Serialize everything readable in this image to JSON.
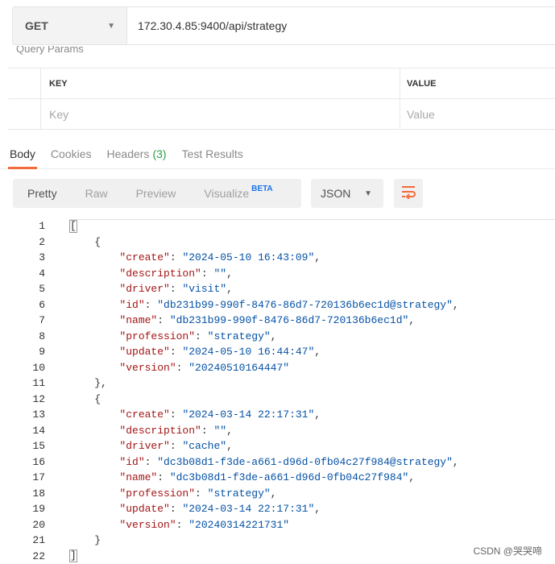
{
  "request": {
    "method": "GET",
    "url": "172.30.4.85:9400/api/strategy"
  },
  "params": {
    "cut_label": "Query Params",
    "col_key": "KEY",
    "col_value": "VALUE",
    "placeholder_key": "Key",
    "placeholder_value": "Value"
  },
  "response_tabs": {
    "body": "Body",
    "cookies": "Cookies",
    "headers": "Headers",
    "headers_count": "(3)",
    "test_results": "Test Results",
    "active": "Body"
  },
  "view": {
    "pretty": "Pretty",
    "raw": "Raw",
    "preview": "Preview",
    "visualize": "Visualize",
    "beta": "BETA",
    "format": "JSON",
    "active": "Pretty"
  },
  "code": {
    "lines": [
      {
        "n": "1",
        "indent": "",
        "parts": [
          [
            "p",
            "["
          ]
        ]
      },
      {
        "n": "2",
        "indent": "    ",
        "parts": [
          [
            "p",
            "{"
          ]
        ]
      },
      {
        "n": "3",
        "indent": "        ",
        "parts": [
          [
            "k",
            "\"create\""
          ],
          [
            "p",
            ": "
          ],
          [
            "v",
            "\"2024-05-10 16:43:09\""
          ],
          [
            "p",
            ","
          ]
        ]
      },
      {
        "n": "4",
        "indent": "        ",
        "parts": [
          [
            "k",
            "\"description\""
          ],
          [
            "p",
            ": "
          ],
          [
            "v",
            "\"\""
          ],
          [
            "p",
            ","
          ]
        ]
      },
      {
        "n": "5",
        "indent": "        ",
        "parts": [
          [
            "k",
            "\"driver\""
          ],
          [
            "p",
            ": "
          ],
          [
            "v",
            "\"visit\""
          ],
          [
            "p",
            ","
          ]
        ]
      },
      {
        "n": "6",
        "indent": "        ",
        "parts": [
          [
            "k",
            "\"id\""
          ],
          [
            "p",
            ": "
          ],
          [
            "v",
            "\"db231b99-990f-8476-86d7-720136b6ec1d@strategy\""
          ],
          [
            "p",
            ","
          ]
        ]
      },
      {
        "n": "7",
        "indent": "        ",
        "parts": [
          [
            "k",
            "\"name\""
          ],
          [
            "p",
            ": "
          ],
          [
            "v",
            "\"db231b99-990f-8476-86d7-720136b6ec1d\""
          ],
          [
            "p",
            ","
          ]
        ]
      },
      {
        "n": "8",
        "indent": "        ",
        "parts": [
          [
            "k",
            "\"profession\""
          ],
          [
            "p",
            ": "
          ],
          [
            "v",
            "\"strategy\""
          ],
          [
            "p",
            ","
          ]
        ]
      },
      {
        "n": "9",
        "indent": "        ",
        "parts": [
          [
            "k",
            "\"update\""
          ],
          [
            "p",
            ": "
          ],
          [
            "v",
            "\"2024-05-10 16:44:47\""
          ],
          [
            "p",
            ","
          ]
        ]
      },
      {
        "n": "10",
        "indent": "        ",
        "parts": [
          [
            "k",
            "\"version\""
          ],
          [
            "p",
            ": "
          ],
          [
            "v",
            "\"20240510164447\""
          ]
        ]
      },
      {
        "n": "11",
        "indent": "    ",
        "parts": [
          [
            "p",
            "},"
          ]
        ]
      },
      {
        "n": "12",
        "indent": "    ",
        "parts": [
          [
            "p",
            "{"
          ]
        ]
      },
      {
        "n": "13",
        "indent": "        ",
        "parts": [
          [
            "k",
            "\"create\""
          ],
          [
            "p",
            ": "
          ],
          [
            "v",
            "\"2024-03-14 22:17:31\""
          ],
          [
            "p",
            ","
          ]
        ]
      },
      {
        "n": "14",
        "indent": "        ",
        "parts": [
          [
            "k",
            "\"description\""
          ],
          [
            "p",
            ": "
          ],
          [
            "v",
            "\"\""
          ],
          [
            "p",
            ","
          ]
        ]
      },
      {
        "n": "15",
        "indent": "        ",
        "parts": [
          [
            "k",
            "\"driver\""
          ],
          [
            "p",
            ": "
          ],
          [
            "v",
            "\"cache\""
          ],
          [
            "p",
            ","
          ]
        ]
      },
      {
        "n": "16",
        "indent": "        ",
        "parts": [
          [
            "k",
            "\"id\""
          ],
          [
            "p",
            ": "
          ],
          [
            "v",
            "\"dc3b08d1-f3de-a661-d96d-0fb04c27f984@strategy\""
          ],
          [
            "p",
            ","
          ]
        ]
      },
      {
        "n": "17",
        "indent": "        ",
        "parts": [
          [
            "k",
            "\"name\""
          ],
          [
            "p",
            ": "
          ],
          [
            "v",
            "\"dc3b08d1-f3de-a661-d96d-0fb04c27f984\""
          ],
          [
            "p",
            ","
          ]
        ]
      },
      {
        "n": "18",
        "indent": "        ",
        "parts": [
          [
            "k",
            "\"profession\""
          ],
          [
            "p",
            ": "
          ],
          [
            "v",
            "\"strategy\""
          ],
          [
            "p",
            ","
          ]
        ]
      },
      {
        "n": "19",
        "indent": "        ",
        "parts": [
          [
            "k",
            "\"update\""
          ],
          [
            "p",
            ": "
          ],
          [
            "v",
            "\"2024-03-14 22:17:31\""
          ],
          [
            "p",
            ","
          ]
        ]
      },
      {
        "n": "20",
        "indent": "        ",
        "parts": [
          [
            "k",
            "\"version\""
          ],
          [
            "p",
            ": "
          ],
          [
            "v",
            "\"20240314221731\""
          ]
        ]
      },
      {
        "n": "21",
        "indent": "    ",
        "parts": [
          [
            "p",
            "}"
          ]
        ]
      },
      {
        "n": "22",
        "indent": "",
        "parts": [
          [
            "p",
            "]"
          ]
        ]
      }
    ]
  },
  "watermark": "CSDN @哭哭啼",
  "colors": {
    "accent_tab": "#f26b3a",
    "headers_count": "#27a243",
    "beta": "#1e74e8",
    "json_key": "#a31515",
    "json_string": "#0451a5",
    "wrap_icon": "#f26b3a"
  }
}
